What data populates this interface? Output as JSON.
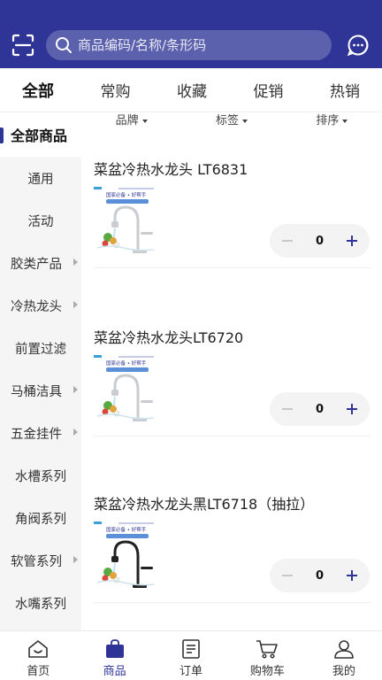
{
  "search": {
    "placeholder": "商品编码/名称/条形码"
  },
  "tabs": [
    {
      "label": "全部",
      "active": true
    },
    {
      "label": "常购",
      "active": false
    },
    {
      "label": "收藏",
      "active": false
    },
    {
      "label": "促销",
      "active": false
    },
    {
      "label": "热销",
      "active": false
    }
  ],
  "sidebar": {
    "all_label": "全部商品",
    "items": [
      {
        "label": "通用",
        "has_arrow": false
      },
      {
        "label": "活动",
        "has_arrow": false
      },
      {
        "label": "胶类产品",
        "has_arrow": true
      },
      {
        "label": "冷热龙头",
        "has_arrow": true
      },
      {
        "label": "前置过滤",
        "has_arrow": false
      },
      {
        "label": "马桶洁具",
        "has_arrow": true
      },
      {
        "label": "五金挂件",
        "has_arrow": true
      },
      {
        "label": "水槽系列",
        "has_arrow": false
      },
      {
        "label": "角阀系列",
        "has_arrow": false
      },
      {
        "label": "软管系列",
        "has_arrow": true
      },
      {
        "label": "水嘴系列",
        "has_arrow": false
      }
    ]
  },
  "filters": [
    {
      "label": "品牌"
    },
    {
      "label": "标签"
    },
    {
      "label": "排序"
    }
  ],
  "products": [
    {
      "name": "菜盆冷热水龙头 LT6831",
      "qty": "0",
      "thumb_title": "国家必备 • 好帮手",
      "faucet_color": "#c9ccd1"
    },
    {
      "name": "菜盆冷热水龙头LT6720",
      "qty": "0",
      "thumb_title": "国家必备 • 好帮手",
      "faucet_color": "#c9ccd1"
    },
    {
      "name": "菜盆冷热水龙头黑LT6718（抽拉）",
      "qty": "0",
      "thumb_title": "国家必备 • 好帮手",
      "faucet_color": "#222222"
    }
  ],
  "bottom_nav": [
    {
      "label": "首页",
      "icon": "home-icon",
      "active": false
    },
    {
      "label": "商品",
      "icon": "bag-icon",
      "active": true
    },
    {
      "label": "订单",
      "icon": "order-icon",
      "active": false
    },
    {
      "label": "购物车",
      "icon": "cart-icon",
      "active": false
    },
    {
      "label": "我的",
      "icon": "user-icon",
      "active": false
    }
  ],
  "colors": {
    "brand": "#2f3597",
    "sidebar_bg": "#f5f5f5",
    "stepper_bg": "#f3f3f3"
  }
}
